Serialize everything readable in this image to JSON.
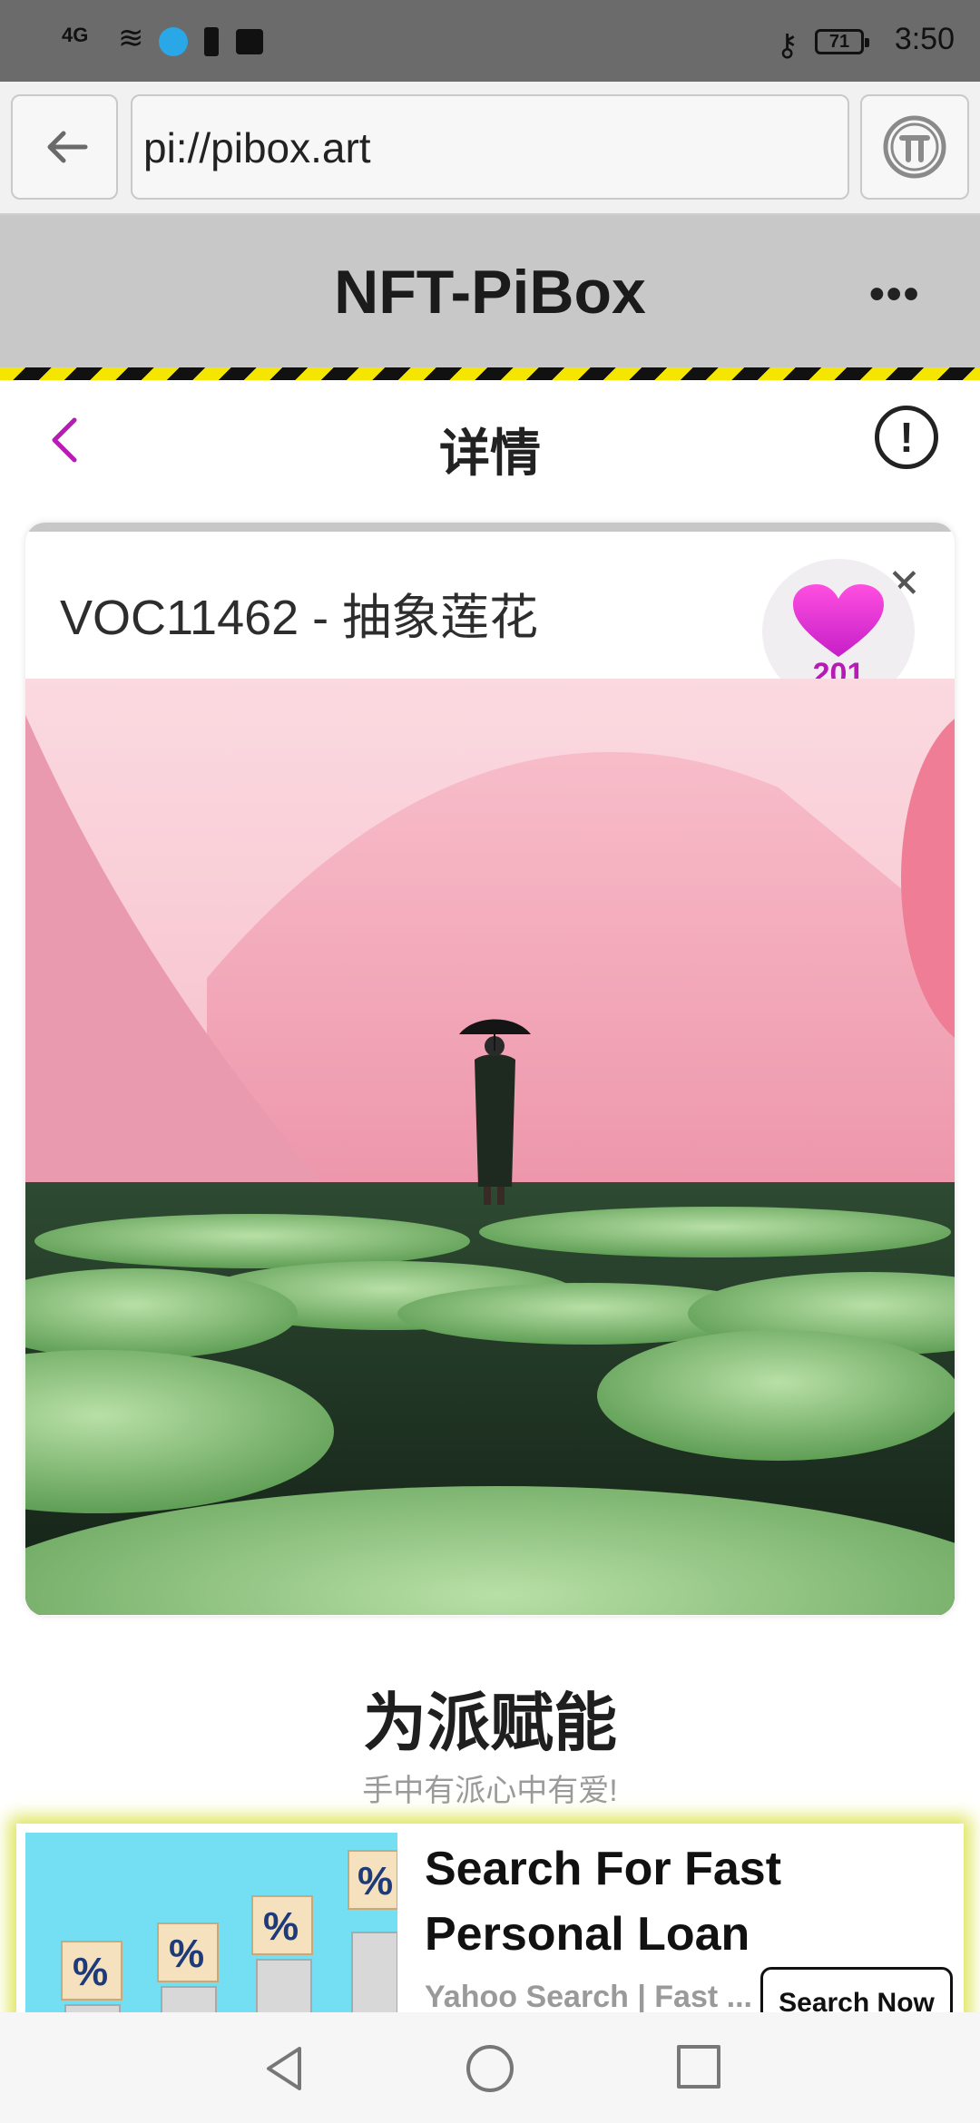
{
  "status_bar": {
    "time": "3:50",
    "battery": "71",
    "signal": "4G"
  },
  "browser": {
    "url": "pi://pibox.art"
  },
  "app": {
    "title": "NFT-PiBox"
  },
  "detail": {
    "title": "详情"
  },
  "card": {
    "title": "VOC11462 - 抽象莲花",
    "likes": "201"
  },
  "slogan": {
    "title": "为派赋能",
    "subtitle": "手中有派心中有爱!"
  },
  "ad": {
    "headline": "Search For Fast Personal Loan",
    "source": "Yahoo Search | Fast ...",
    "button": "Search Now"
  },
  "colors": {
    "accent_purple": "#b81ab5",
    "hazard_yellow": "#f4e600",
    "header_gray": "#c8c8c8"
  }
}
